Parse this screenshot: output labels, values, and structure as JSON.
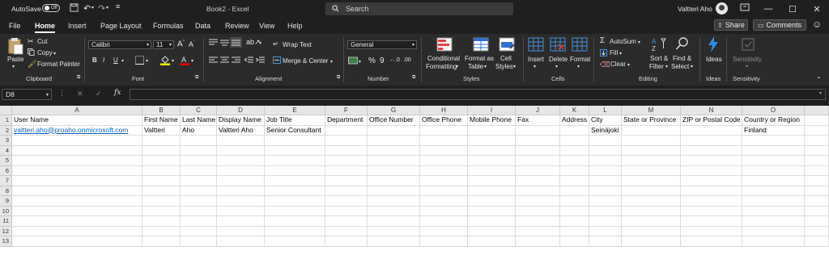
{
  "titlebar": {
    "autosave_label": "AutoSave",
    "autosave_state": "Off",
    "doc_title": "Book2  -  Excel",
    "search_placeholder": "Search",
    "user_name": "Valtteri Aho"
  },
  "menu": {
    "tabs": [
      "File",
      "Home",
      "Insert",
      "Page Layout",
      "Formulas",
      "Data",
      "Review",
      "View",
      "Help"
    ],
    "active": "Home",
    "share_label": "Share",
    "comments_label": "Comments"
  },
  "ribbon": {
    "clipboard": {
      "paste": "Paste",
      "cut": "Cut",
      "copy": "Copy",
      "format_painter": "Format Painter",
      "label": "Clipboard"
    },
    "font": {
      "name": "Calibri",
      "size": "11",
      "label": "Font",
      "bold": "B",
      "italic": "I",
      "underline": "U"
    },
    "alignment": {
      "wrap": "Wrap Text",
      "merge": "Merge & Center",
      "label": "Alignment"
    },
    "number": {
      "format": "General",
      "label": "Number"
    },
    "styles": {
      "conditional": "Conditional",
      "conditional2": "Formatting",
      "format_as": "Format as",
      "table": "Table",
      "cell": "Cell",
      "styles2": "Styles",
      "label": "Styles"
    },
    "cells": {
      "insert": "Insert",
      "delete": "Delete",
      "format": "Format",
      "label": "Cells"
    },
    "editing": {
      "autosum": "AutoSum",
      "fill": "Fill",
      "clear": "Clear",
      "sort": "Sort &",
      "filter": "Filter",
      "find": "Find &",
      "select": "Select",
      "label": "Editing"
    },
    "ideas": {
      "ideas": "Ideas",
      "label": "Ideas"
    },
    "sensitivity": {
      "sensitivity": "Sensitivity",
      "label": "Sensitivity"
    }
  },
  "formula_bar": {
    "name_box": "D8",
    "formula": ""
  },
  "columns": [
    "A",
    "B",
    "C",
    "D",
    "E",
    "F",
    "G",
    "H",
    "I",
    "J",
    "K",
    "L",
    "M",
    "N",
    "O"
  ],
  "rows": [
    "1",
    "2",
    "3",
    "4",
    "5",
    "6",
    "7",
    "8",
    "9",
    "10",
    "11",
    "12",
    "13"
  ],
  "cells": {
    "row1": [
      "User Name",
      "First Name",
      "Last Name",
      "Display Name",
      "Job Title",
      "Department",
      "Office Number",
      "Office Phone",
      "Mobile Phone",
      "Fax",
      "Address",
      "City",
      "State or Province",
      "ZIP or Postal Code",
      "Country or Region"
    ],
    "row2": [
      "valtteri.aho@proaho.onmicrosoft.com",
      "Valtteri",
      "Aho",
      "Valtteri Aho",
      "Senior Consultant",
      "",
      "",
      "",
      "",
      "",
      "",
      "Seinäjoki",
      "",
      "",
      "Finland"
    ]
  },
  "colors": {
    "accent_active_tab": "#ffffff",
    "link": "#0563c1",
    "ribbon_bg": "#2b2b2b",
    "titlebar_bg": "#1f1f1f"
  }
}
